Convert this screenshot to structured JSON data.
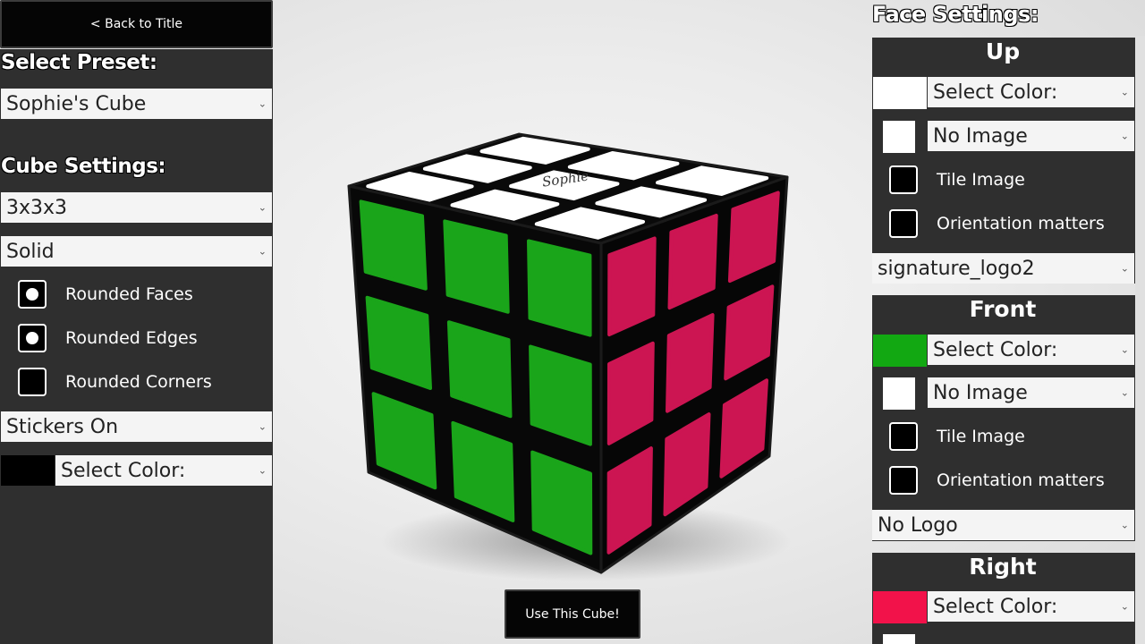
{
  "left_panel": {
    "back_button": "< Back to Title",
    "select_preset_heading": "Select Preset:",
    "preset_value": "Sophie's Cube",
    "cube_settings_heading": "Cube Settings:",
    "size_value": "3x3x3",
    "style_value": "Solid",
    "options": [
      {
        "label": "Rounded Faces",
        "checked": true
      },
      {
        "label": "Rounded Edges",
        "checked": true
      },
      {
        "label": "Rounded Corners",
        "checked": false
      }
    ],
    "stickers_value": "Stickers On",
    "sticker_color": "#000000",
    "select_color": "Select Color:"
  },
  "center": {
    "use_button": "Use This Cube!",
    "cube_logo_text": "Sophie",
    "colors": {
      "up": "#ffffff",
      "front": "#1aa51a",
      "right": "#cc1552",
      "body": "#0a0a0a"
    }
  },
  "right_panel": {
    "heading": "Face Settings:",
    "faces": [
      {
        "name": "Up",
        "color": "#ffffff",
        "select_color": "Select Color:",
        "image_swatch": "#ffffff",
        "image_value": "No Image",
        "tile_image": "Tile Image",
        "orientation": "Orientation matters",
        "logo_value": "signature_logo2"
      },
      {
        "name": "Front",
        "color": "#12a812",
        "select_color": "Select Color:",
        "image_swatch": "#ffffff",
        "image_value": "No Image",
        "tile_image": "Tile Image",
        "orientation": "Orientation matters",
        "logo_value": "No Logo"
      },
      {
        "name": "Right",
        "color": "#f2124a",
        "select_color": "Select Color:"
      }
    ]
  }
}
